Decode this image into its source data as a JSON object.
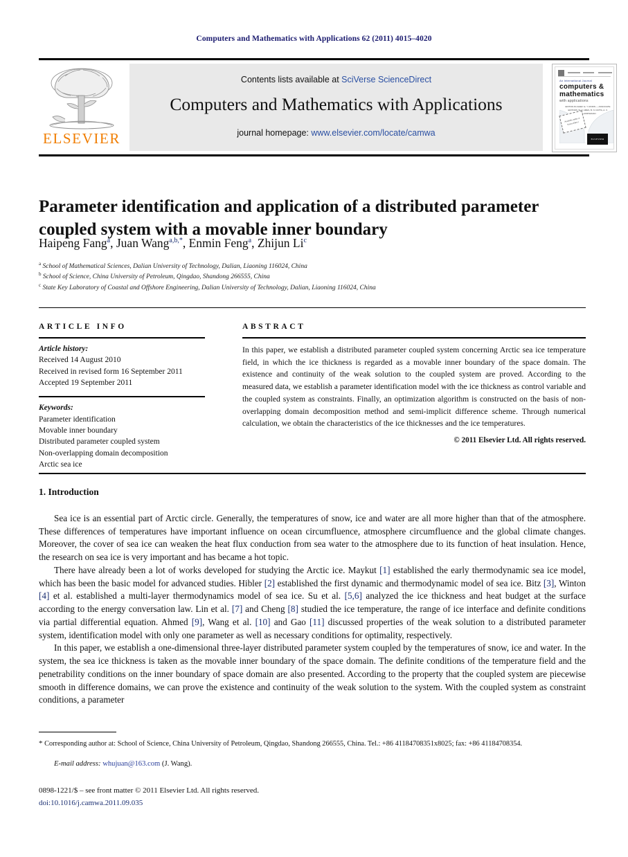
{
  "running_head": "Computers and Mathematics with Applications 62 (2011) 4015–4020",
  "masthead": {
    "publisher_logo_text": "ELSEVIER",
    "contents_prefix": "Contents lists available at ",
    "contents_link": "SciVerse ScienceDirect",
    "journal_title": "Computers and Mathematics with Applications",
    "homepage_prefix": "journal homepage: ",
    "homepage_url": "www.elsevier.com/locate/camwa",
    "cover": {
      "kicker": "An International Journal",
      "title_line1": "computers &",
      "title_line2": "mathematics",
      "title_line3": "with applications",
      "editors": "EDITOR-IN-CHIEF: E. Y. RODIN — ASSOCIATE EDITORS: W. F. AMES, B. N. DATTA, A. V. BALAKRISHNAN",
      "burst_text": "Available online at ScienceDirect",
      "badge_text": "ELSEVIER"
    }
  },
  "article": {
    "title": "Parameter identification and application of a distributed parameter coupled system with a movable inner boundary",
    "authors": [
      {
        "name": "Haipeng Fang",
        "marks": "a"
      },
      {
        "name": "Juan Wang",
        "marks": "a,b,*"
      },
      {
        "name": "Enmin Feng",
        "marks": "a"
      },
      {
        "name": "Zhijun Li",
        "marks": "c"
      }
    ],
    "affiliations": [
      {
        "label": "a",
        "text": "School of Mathematical Sciences, Dalian University of Technology, Dalian, Liaoning 116024, China"
      },
      {
        "label": "b",
        "text": "School of Science, China University of Petroleum, Qingdao, Shandong 266555, China"
      },
      {
        "label": "c",
        "text": "State Key Laboratory of Coastal and Offshore Engineering, Dalian University of Technology, Dalian, Liaoning 116024, China"
      }
    ]
  },
  "article_info": {
    "heading": "ARTICLE INFO",
    "history_label": "Article history:",
    "history": [
      "Received 14 August 2010",
      "Received in revised form 16 September 2011",
      "Accepted 19 September 2011"
    ],
    "keywords_label": "Keywords:",
    "keywords": [
      "Parameter identification",
      "Movable inner boundary",
      "Distributed parameter coupled system",
      "Non-overlapping domain decomposition",
      "Arctic sea ice"
    ]
  },
  "abstract": {
    "heading": "ABSTRACT",
    "text": "In this paper, we establish a distributed parameter coupled system concerning Arctic sea ice temperature field, in which the ice thickness is regarded as a movable inner boundary of the space domain. The existence and continuity of the weak solution to the coupled system are proved. According to the measured data, we establish a parameter identification model with the ice thickness as control variable and the coupled system as constraints. Finally, an optimization algorithm is constructed on the basis of non-overlapping domain decomposition method and semi-implicit difference scheme. Through numerical calculation, we obtain the characteristics of the ice thicknesses and the ice temperatures.",
    "copyright": "© 2011 Elsevier Ltd. All rights reserved."
  },
  "body": {
    "section_number_title": "1. Introduction",
    "paragraph1": "Sea ice is an essential part of Arctic circle. Generally, the temperatures of snow, ice and water are all more higher than that of the atmosphere. These differences of temperatures have important influence on ocean circumfluence, atmosphere circumfluence and the global climate changes. Moreover, the cover of sea ice can weaken the heat flux conduction from sea water to the atmosphere due to its function of heat insulation. Hence, the research on sea ice is very important and has became a hot topic.",
    "paragraph2_parts": [
      "There have already been a lot of works developed for studying the Arctic ice. Maykut ",
      "[1]",
      " established the early thermodynamic sea ice model, which has been the basic model for advanced studies. Hibler ",
      "[2]",
      " established the first dynamic and thermodynamic model of sea ice. Bitz ",
      "[3]",
      ", Winton ",
      "[4]",
      " et al. established a multi-layer thermodynamics model of sea ice. Su et al. ",
      "[5,6]",
      " analyzed the ice thickness and heat budget at the surface according to the energy conversation law. Lin et al. ",
      "[7]",
      " and Cheng ",
      "[8]",
      " studied the ice temperature, the range of ice interface and definite conditions via partial differential equation. Ahmed ",
      "[9]",
      ", Wang et al. ",
      "[10]",
      " and Gao ",
      "[11]",
      " discussed properties of the weak solution to a distributed parameter system, identification model with only one parameter as well as necessary conditions for optimality, respectively."
    ],
    "paragraph3": "In this paper, we establish a one-dimensional three-layer distributed parameter system coupled by the temperatures of snow, ice and water. In the system, the sea ice thickness is taken as the movable inner boundary of the space domain. The definite conditions of the temperature field and the penetrability conditions on the inner boundary of space domain are also presented. According to the property that the coupled system are piecewise smooth in difference domains, we can prove the existence and continuity of the weak solution to the system. With the coupled system as constraint conditions, a parameter"
  },
  "footer": {
    "corresponding_note": "Corresponding author at: School of Science, China University of Petroleum, Qingdao, Shandong 266555, China. Tel.: +86 41184708351x8025; fax: +86 41184708354.",
    "email_label": "E-mail address:",
    "email": "whujuan@163.com",
    "email_suffix": "(J. Wang).",
    "issn_line": "0898-1221/$ – see front matter © 2011 Elsevier Ltd. All rights reserved.",
    "doi_line": "doi:10.1016/j.camwa.2011.09.035"
  },
  "colors": {
    "link_blue": "#2a4fa2",
    "running_head_navy": "#1b1b6f",
    "elsevier_orange": "#f07d00",
    "banner_grey": "#e9e9e9"
  }
}
